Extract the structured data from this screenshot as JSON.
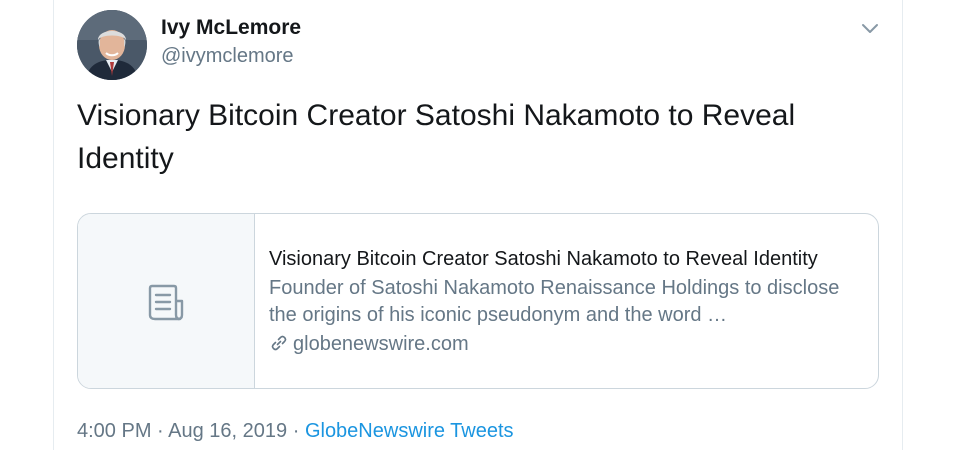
{
  "author": {
    "name": "Ivy McLemore",
    "handle": "@ivymclemore"
  },
  "tweet": {
    "text": "Visionary Bitcoin Creator Satoshi Nakamoto to Reveal Identity"
  },
  "card": {
    "title": "Visionary Bitcoin Creator Satoshi Nakamoto to Reveal Identity",
    "description": "Founder of Satoshi Nakamoto Renaissance Holdings to disclose the origins of his iconic pseudonym and the word …",
    "domain": "globenewswire.com"
  },
  "meta": {
    "time": "4:00 PM",
    "separator1": " · ",
    "date": "Aug 16, 2019",
    "separator2": " · ",
    "source": "GlobeNewswire Tweets"
  },
  "icons": {
    "menu": "chevron-down-icon",
    "thumbnail": "document-icon",
    "domain": "link-icon"
  },
  "colors": {
    "text": "#14171a",
    "secondary": "#657786",
    "link": "#1b95e0",
    "border": "#ccd6dd",
    "thumb_bg": "#f5f8fa"
  }
}
